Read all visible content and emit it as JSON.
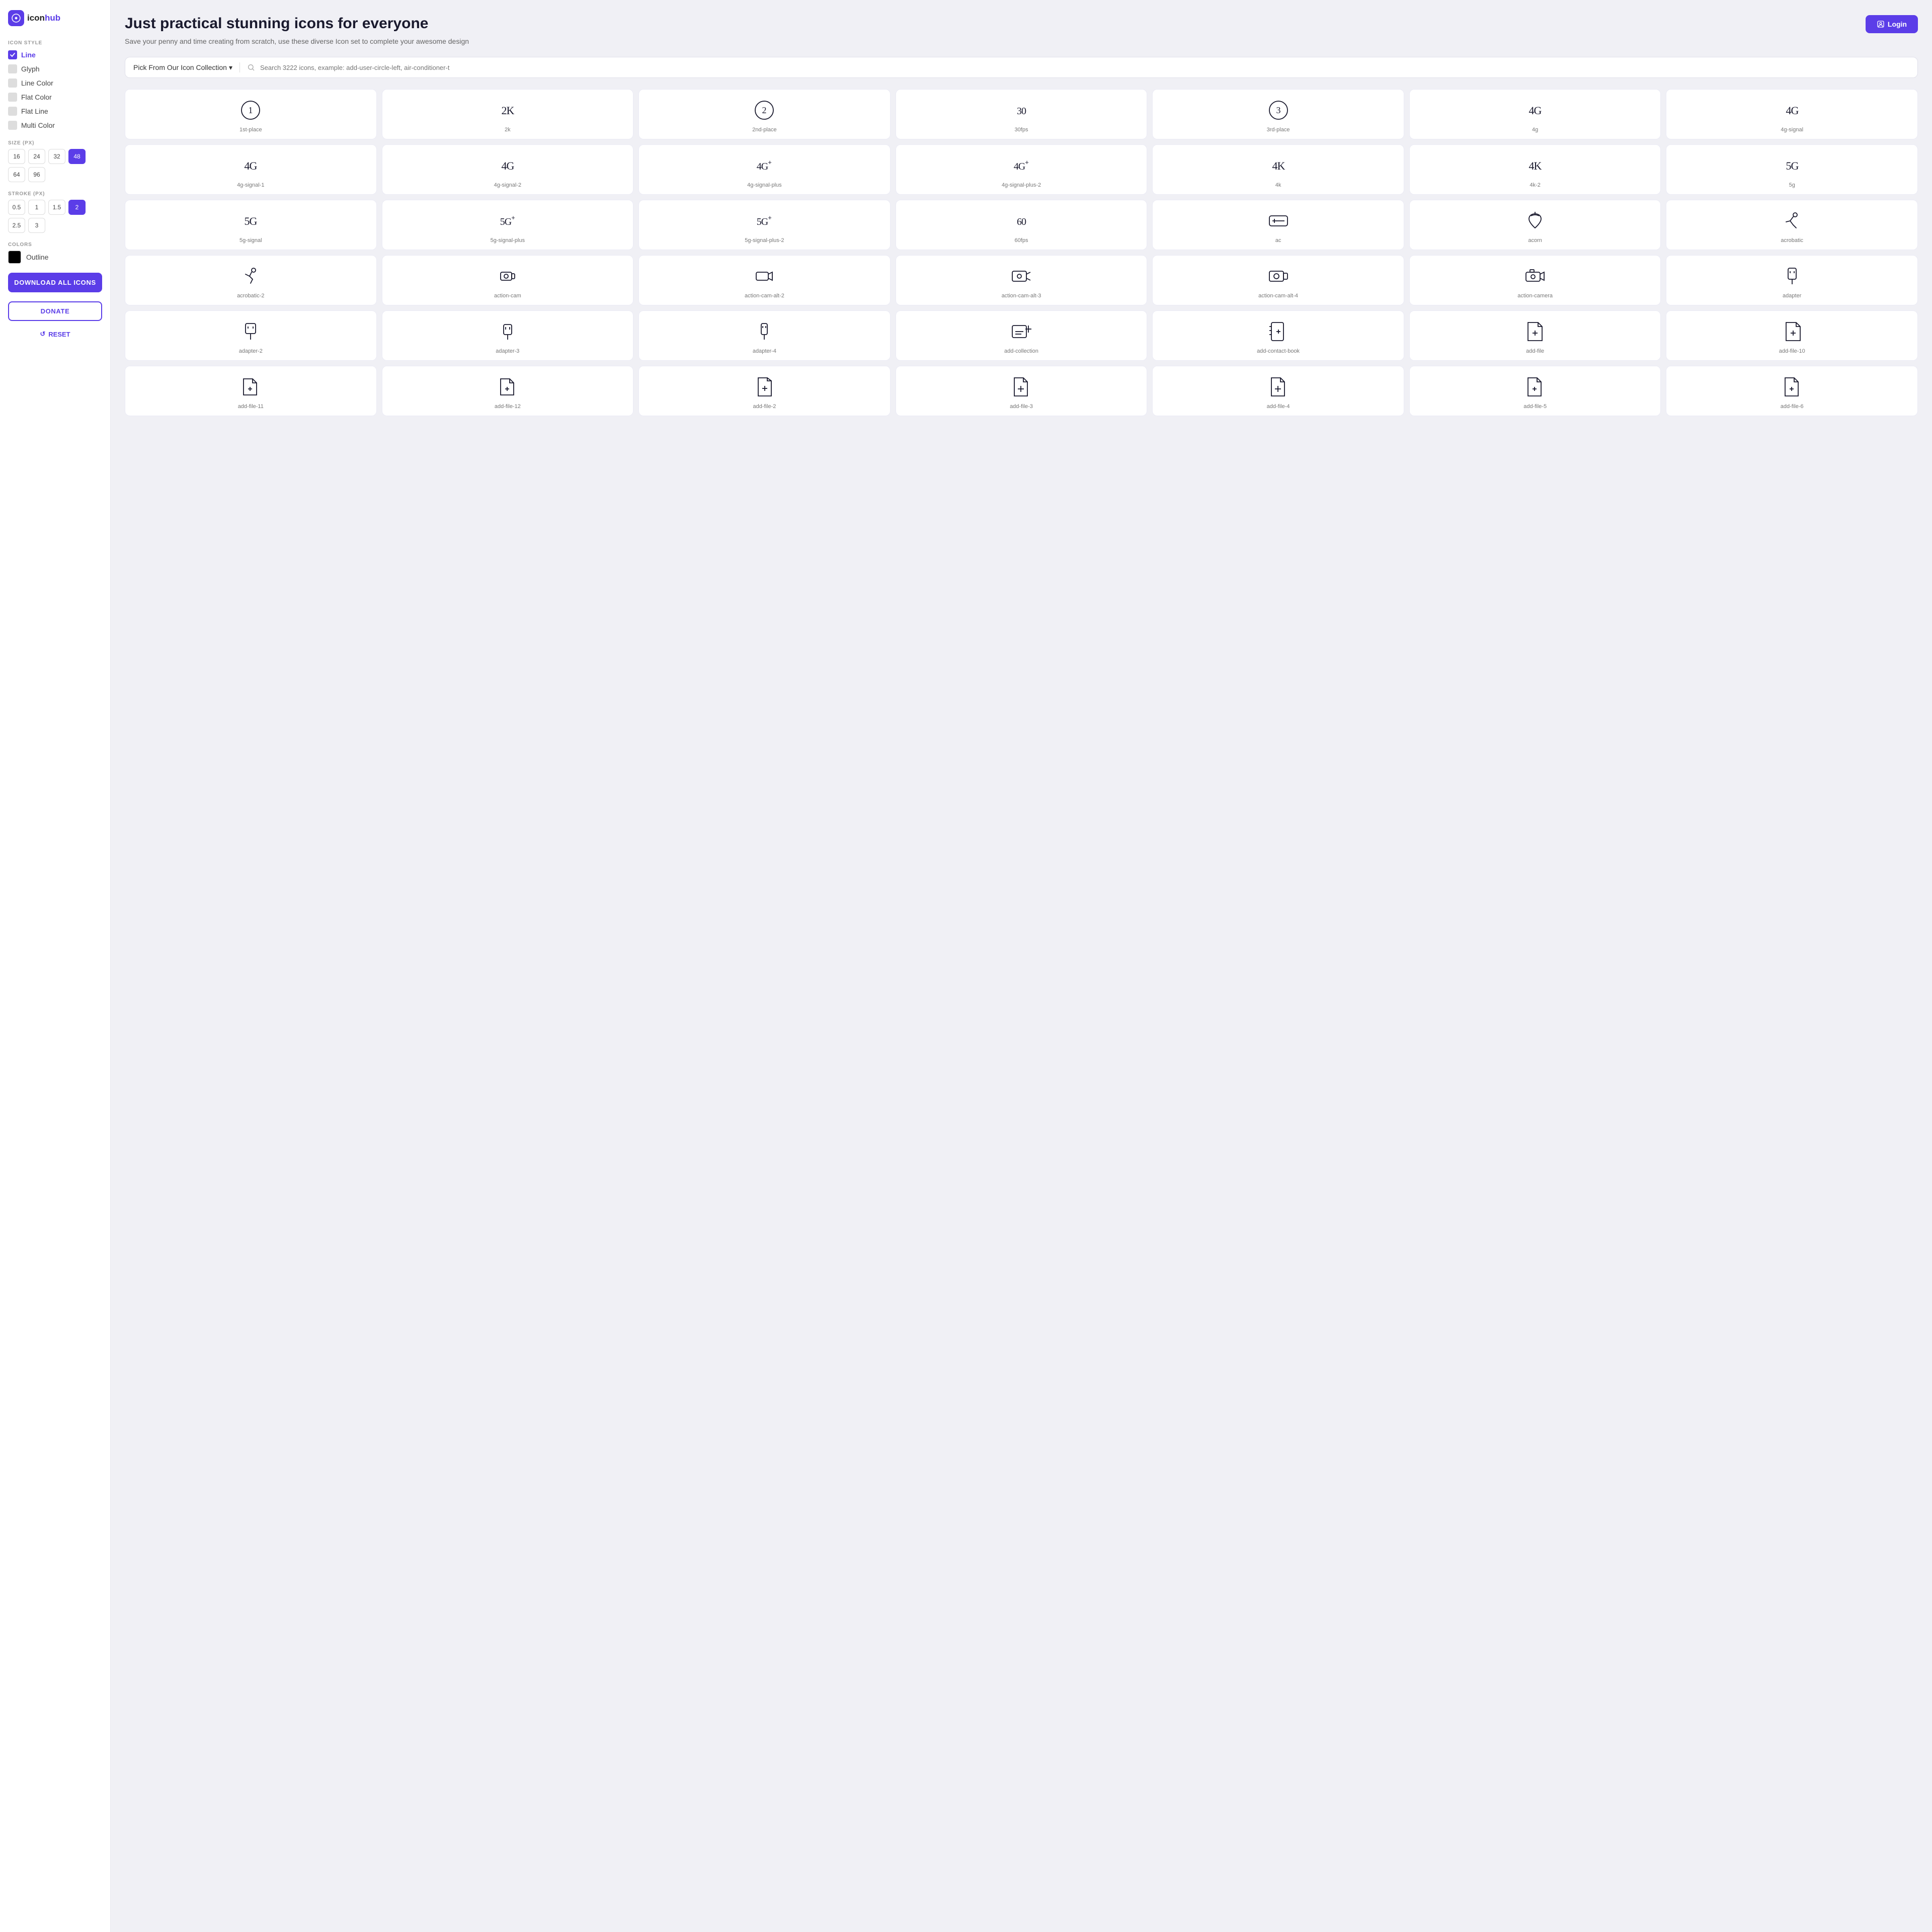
{
  "sidebar": {
    "logo_icon": "c",
    "logo_brand": "icon",
    "logo_suffix": "hub",
    "icon_style_label": "ICON STYLE",
    "styles": [
      {
        "id": "line",
        "label": "Line",
        "active": true
      },
      {
        "id": "glyph",
        "label": "Glyph",
        "active": false
      },
      {
        "id": "line-color",
        "label": "Line Color",
        "active": false
      },
      {
        "id": "flat-color",
        "label": "Flat Color",
        "active": false
      },
      {
        "id": "flat-line",
        "label": "Flat Line",
        "active": false
      },
      {
        "id": "multi-color",
        "label": "Multi Color",
        "active": false
      }
    ],
    "size_label": "SIZE (PX)",
    "sizes": [
      "16",
      "24",
      "32",
      "48",
      "64",
      "96"
    ],
    "active_size": "48",
    "stroke_label": "STROKE (PX)",
    "strokes": [
      "0.5",
      "1",
      "1.5",
      "2",
      "2.5",
      "3"
    ],
    "active_stroke": "2",
    "colors_label": "COLORS",
    "outline_label": "Outline",
    "download_label": "DOWNLOAD ALL ICONS",
    "donate_label": "DONATE",
    "reset_label": "RESET"
  },
  "header": {
    "title": "Just practical stunning icons for everyone",
    "subtitle": "Save your penny and time creating from scratch, use these diverse Icon set to complete your awesome design",
    "login_label": "Login"
  },
  "search": {
    "collection_label": "Pick From Our Icon Collection",
    "placeholder": "Search 3222 icons, example: add-user-circle-left, air-conditioner-t"
  },
  "icons": [
    {
      "id": "1st-place",
      "label": "1st-place",
      "shape": "circle-1"
    },
    {
      "id": "2k",
      "label": "2k",
      "shape": "text-2k"
    },
    {
      "id": "2nd-place",
      "label": "2nd-place",
      "shape": "circle-2"
    },
    {
      "id": "30fps",
      "label": "30fps",
      "shape": "text-30"
    },
    {
      "id": "3rd-place",
      "label": "3rd-place",
      "shape": "circle-3"
    },
    {
      "id": "4g",
      "label": "4g",
      "shape": "text-4g"
    },
    {
      "id": "4g-signal",
      "label": "4g-signal",
      "shape": "text-4g-b"
    },
    {
      "id": "4g-signal-1",
      "label": "4g-signal-1",
      "shape": "text-4g-1"
    },
    {
      "id": "4g-signal-2",
      "label": "4g-signal-2",
      "shape": "text-4g-2"
    },
    {
      "id": "4g-signal-plus",
      "label": "4g-signal-plus",
      "shape": "text-4gp"
    },
    {
      "id": "4g-signal-plus-2",
      "label": "4g-signal-plus-2",
      "shape": "text-4gp2"
    },
    {
      "id": "4k",
      "label": "4k",
      "shape": "text-4k"
    },
    {
      "id": "4k-2",
      "label": "4k-2",
      "shape": "text-4k2"
    },
    {
      "id": "5g",
      "label": "5g",
      "shape": "text-5g"
    },
    {
      "id": "5g-signal",
      "label": "5g-signal",
      "shape": "text-5gs"
    },
    {
      "id": "5g-signal-plus",
      "label": "5g-signal-plus",
      "shape": "text-5gp"
    },
    {
      "id": "5g-signal-plus-2",
      "label": "5g-signal-plus-2",
      "shape": "text-5gp2"
    },
    {
      "id": "60fps",
      "label": "60fps",
      "shape": "text-60"
    },
    {
      "id": "ac",
      "label": "ac",
      "shape": "ac"
    },
    {
      "id": "acorn",
      "label": "acorn",
      "shape": "acorn"
    },
    {
      "id": "acrobatic",
      "label": "acrobatic",
      "shape": "acrobatic"
    },
    {
      "id": "acrobatic-2",
      "label": "acrobatic-2",
      "shape": "acrobatic2"
    },
    {
      "id": "action-cam",
      "label": "action-cam",
      "shape": "action-cam"
    },
    {
      "id": "action-cam-alt-2",
      "label": "action-cam-alt-2",
      "shape": "action-cam-alt2"
    },
    {
      "id": "action-cam-alt-3",
      "label": "action-cam-alt-3",
      "shape": "action-cam-alt3"
    },
    {
      "id": "action-cam-alt-4",
      "label": "action-cam-alt-4",
      "shape": "action-cam-alt4"
    },
    {
      "id": "action-camera",
      "label": "action-camera",
      "shape": "action-camera"
    },
    {
      "id": "adapter",
      "label": "adapter",
      "shape": "adapter"
    },
    {
      "id": "adapter-2",
      "label": "adapter-2",
      "shape": "adapter2"
    },
    {
      "id": "adapter-3",
      "label": "adapter-3",
      "shape": "adapter3"
    },
    {
      "id": "adapter-4",
      "label": "adapter-4",
      "shape": "adapter4"
    },
    {
      "id": "add-collection",
      "label": "add-collection",
      "shape": "add-collection"
    },
    {
      "id": "add-contact-book",
      "label": "add-contact-book",
      "shape": "add-contact-book"
    },
    {
      "id": "add-file",
      "label": "add-file",
      "shape": "add-file"
    },
    {
      "id": "add-file-10",
      "label": "add-file-10",
      "shape": "add-file-10"
    },
    {
      "id": "add-file-11",
      "label": "add-file-11",
      "shape": "add-file-11"
    },
    {
      "id": "add-file-12",
      "label": "add-file-12",
      "shape": "add-file-12"
    },
    {
      "id": "add-file-2",
      "label": "add-file-2",
      "shape": "add-file-2"
    },
    {
      "id": "add-file-3",
      "label": "add-file-3",
      "shape": "add-file-3"
    },
    {
      "id": "add-file-4",
      "label": "add-file-4",
      "shape": "add-file-4"
    },
    {
      "id": "add-file-5",
      "label": "add-file-5",
      "shape": "add-file-5"
    },
    {
      "id": "add-file-6",
      "label": "add-file-6",
      "shape": "add-file-6"
    }
  ]
}
